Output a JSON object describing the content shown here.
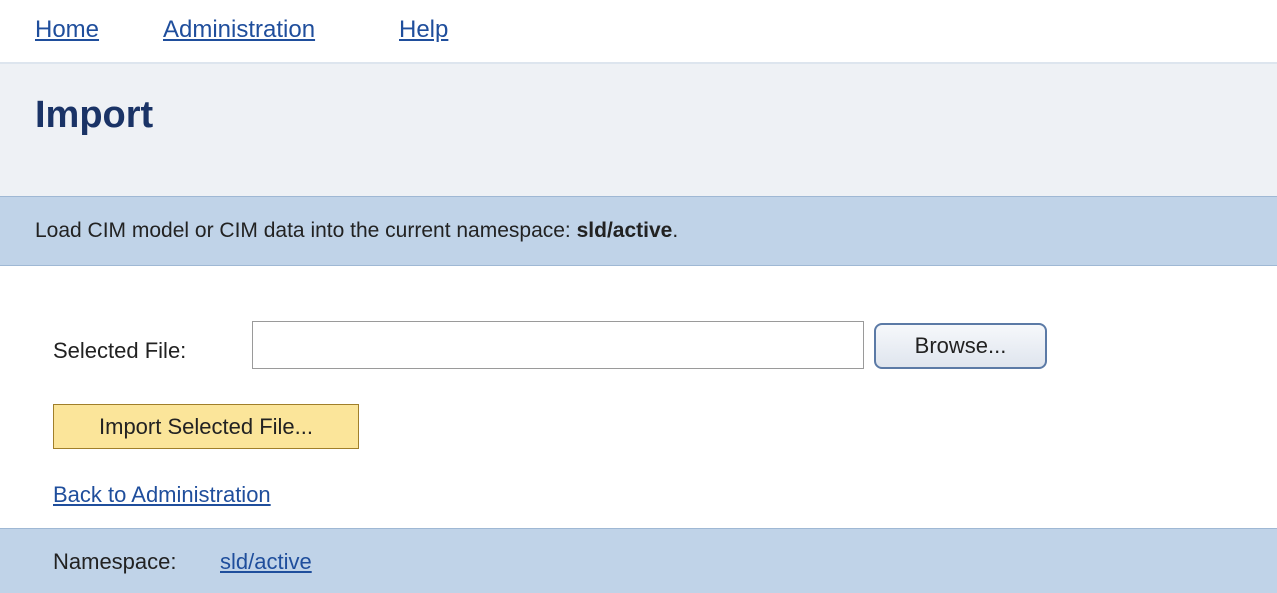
{
  "nav": {
    "home": "Home",
    "administration": "Administration",
    "help": "Help"
  },
  "page": {
    "title": "Import"
  },
  "info": {
    "prefix": "Load CIM model or CIM data into the current namespace: ",
    "namespace": "sld/active",
    "suffix": "."
  },
  "form": {
    "file_label": "Selected File:",
    "file_value": "",
    "browse_label": "Browse...",
    "import_label": "Import Selected File..."
  },
  "links": {
    "back": "Back to Administration"
  },
  "footer": {
    "label": "Namespace:",
    "namespace_link": "sld/active"
  },
  "colors": {
    "link": "#1f4e9c",
    "title": "#1a3366",
    "band": "#c0d3e8",
    "title_band": "#eef1f5",
    "import_button": "#fbe59a"
  }
}
